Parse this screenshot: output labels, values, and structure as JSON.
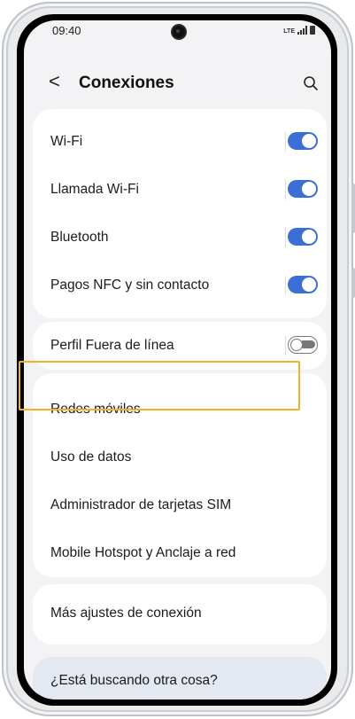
{
  "status_bar": {
    "time": "09:40",
    "network": "LTE"
  },
  "header": {
    "back_glyph": "<",
    "title": "Conexiones",
    "search_icon": "search-icon"
  },
  "groups": [
    {
      "items": [
        {
          "label": "Wi-Fi",
          "toggle": "on"
        },
        {
          "label": "Llamada Wi-Fi",
          "toggle": "on"
        },
        {
          "label": "Bluetooth",
          "toggle": "on"
        },
        {
          "label": "Pagos NFC y sin contacto",
          "toggle": "on"
        }
      ]
    },
    {
      "items": [
        {
          "label": "Perfil Fuera de línea",
          "toggle": "off"
        }
      ]
    },
    {
      "items": [
        {
          "label": "Redes móviles",
          "highlighted": true
        },
        {
          "label": "Uso de datos"
        },
        {
          "label": "Administrador de tarjetas SIM"
        },
        {
          "label": "Mobile Hotspot y Anclaje a red"
        }
      ]
    },
    {
      "items": [
        {
          "label": "Más ajustes de conexión"
        }
      ]
    }
  ],
  "footer_card": {
    "label": "¿Está buscando otra cosa?"
  },
  "colors": {
    "accent": "#3b6fd6",
    "highlight": "#f0b323",
    "background": "#f3f3f5"
  }
}
